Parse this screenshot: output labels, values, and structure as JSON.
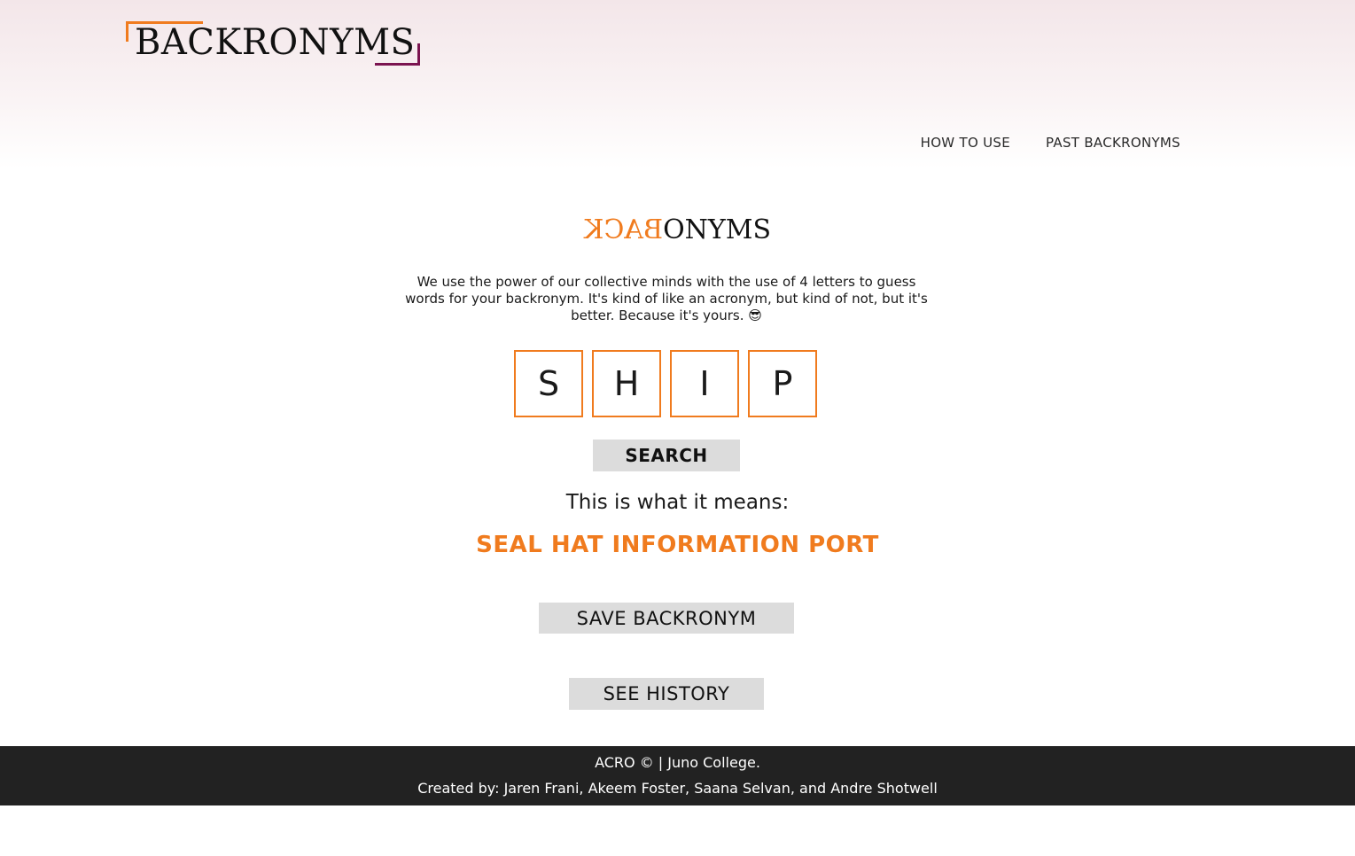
{
  "header": {
    "logo_text": "BACKRONYMS",
    "nav": {
      "how_to_use": "HOW TO USE",
      "past_backronyms": "PAST BACKRONYMS"
    }
  },
  "main": {
    "brand_title_mirrored": "BACK",
    "brand_title_rest": "ONYMS",
    "description": "We use the power of our collective minds with the use of 4 letters to guess words for your backronym. It's kind of like an acronym, but kind of not, but it's better. Because it's yours. 😎",
    "letters": [
      "S",
      "H",
      "I",
      "P"
    ],
    "search_label": "SEARCH",
    "meaning_label": "This is what it means:",
    "meaning_result": "SEAL HAT INFORMATION PORT",
    "save_label": "SAVE BACKRONYM",
    "history_label": "SEE HISTORY"
  },
  "footer": {
    "copyright": "ACRO © | Juno College.",
    "credits": "Created by: Jaren Frani, Akeem Foster, Saana Selvan, and Andre Shotwell"
  },
  "colors": {
    "accent_orange": "#f07b1e",
    "accent_plum": "#7b1450",
    "footer_bg": "#222222",
    "button_bg": "#dcdcdc"
  }
}
